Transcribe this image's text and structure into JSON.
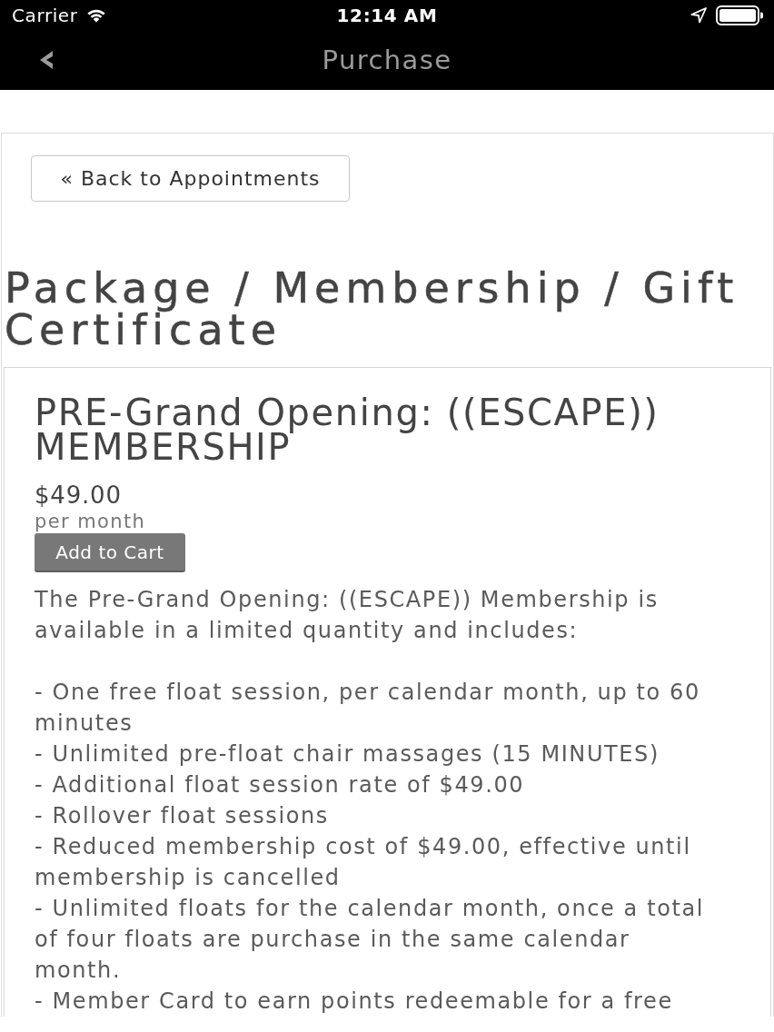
{
  "status_bar": {
    "carrier": "Carrier",
    "time": "12:14 AM"
  },
  "nav_bar": {
    "title": "Purchase"
  },
  "back_button": {
    "label": "« Back to Appointments"
  },
  "heading": "Package / Membership / Gift Certificate",
  "product": {
    "title": "PRE-Grand Opening: ((ESCAPE)) MEMBERSHIP",
    "price": "$49.00",
    "period": "per month",
    "add_button": "Add to Cart",
    "intro": "The Pre-Grand Opening: ((ESCAPE)) Membership is available in a limited quantity and includes:",
    "features": [
      "- One free float session, per calendar month, up to 60 minutes",
      "- Unlimited pre-float chair massages (15 MINUTES)",
      "- Additional float session rate of $49.00",
      "- Rollover float sessions",
      "- Reduced membership cost of $49.00, effective until membership is cancelled",
      "- Unlimited floats for the calendar month, once a total of four floats are purchase in the same calendar month.",
      "- Member Card to earn points redeemable for a free"
    ]
  }
}
